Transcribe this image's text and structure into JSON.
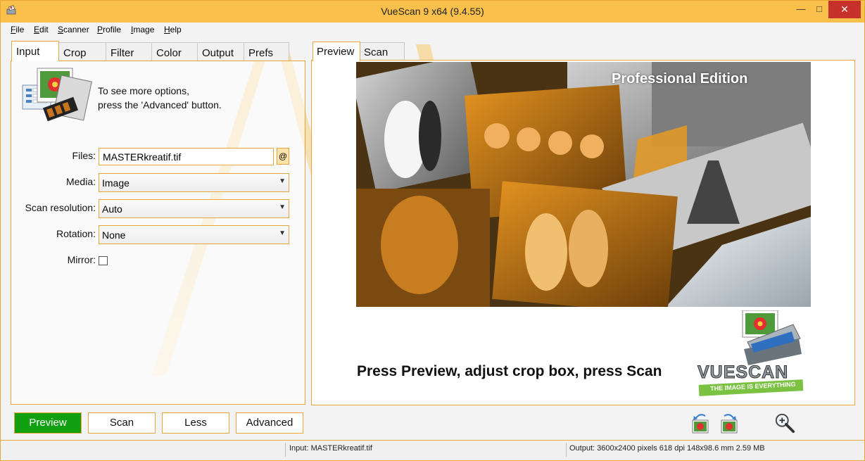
{
  "window": {
    "title": "VueScan 9 x64 (9.4.55)"
  },
  "controls": {
    "minimize": "—",
    "maximize": "□",
    "close": "✕"
  },
  "menu": [
    {
      "first": "F",
      "rest": "ile"
    },
    {
      "first": "E",
      "rest": "dit"
    },
    {
      "first": "S",
      "rest": "canner"
    },
    {
      "first": "P",
      "rest": "rofile"
    },
    {
      "first": "I",
      "rest": "mage"
    },
    {
      "first": "H",
      "rest": "elp"
    }
  ],
  "left_tabs": [
    "Input",
    "Crop",
    "Filter",
    "Color",
    "Output",
    "Prefs"
  ],
  "hint": {
    "line1": "To see more options,",
    "line2": "press the 'Advanced' button."
  },
  "fields": {
    "files": {
      "label": "Files:",
      "value": "MASTERkreatif.tif",
      "at_button": "@"
    },
    "media": {
      "label": "Media:",
      "value": "Image"
    },
    "scan_resolution": {
      "label": "Scan resolution:",
      "value": "Auto"
    },
    "rotation": {
      "label": "Rotation:",
      "value": "None"
    },
    "mirror": {
      "label": "Mirror:",
      "checked": false
    }
  },
  "right_tabs": [
    "Preview",
    "Scan"
  ],
  "preview": {
    "edition": "Professional Edition",
    "instruction": "Press Preview, adjust crop box, press Scan",
    "logo_text": "VUESCAN",
    "logo_tagline": "THE IMAGE IS EVERYTHING"
  },
  "buttons": {
    "preview": "Preview",
    "scan": "Scan",
    "less": "Less",
    "advanced": "Advanced"
  },
  "status": {
    "input": "Input: MASTERkreatif.tif",
    "output": "Output: 3600x2400 pixels 618 dpi 148x98.6 mm 2.59 MB"
  },
  "colors": {
    "accent": "#e8a63a",
    "titlebar": "#f9c04b",
    "preview_button": "#10a010",
    "close": "#c7312c"
  }
}
